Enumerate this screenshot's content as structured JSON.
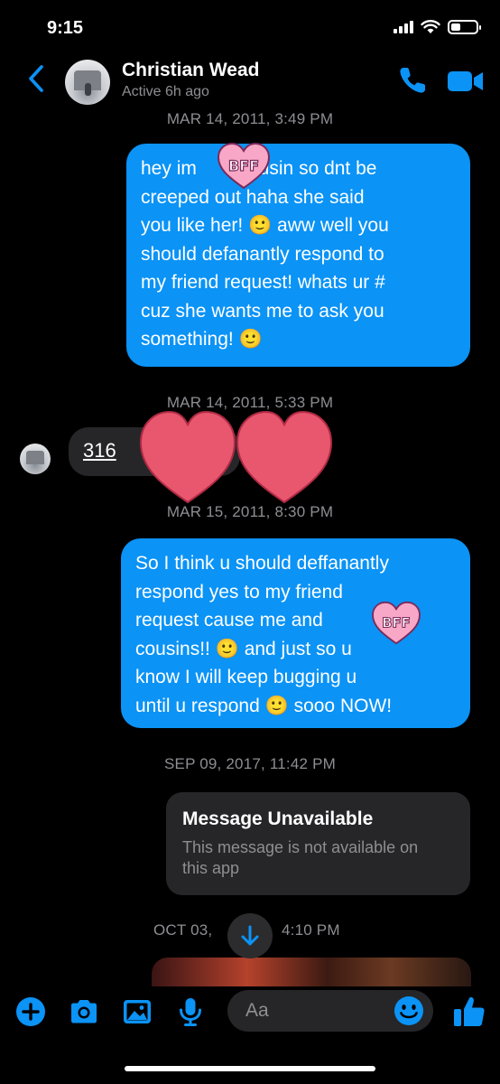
{
  "status_bar": {
    "time": "9:15",
    "battery_fraction": 0.4
  },
  "header": {
    "contact_name": "Christian Wead",
    "contact_status": "Active 6h ago",
    "accent_color": "#0b93f6",
    "icons": [
      "back-chevron-icon",
      "phone-icon",
      "video-camera-icon"
    ]
  },
  "messages": [
    {
      "type": "timestamp",
      "text": "MAR 14, 2011, 3:49 PM"
    },
    {
      "type": "outgoing",
      "lines": [
        "hey im        cousin so dnt be",
        "creeped out haha she said",
        "you like her! 🙂 aww well you",
        "should defanantly respond to",
        "my friend request! whats ur #",
        "cuz she wants me to ask you",
        "something! 🙂"
      ],
      "sticker": "BFF"
    },
    {
      "type": "timestamp",
      "text": "MAR 14, 2011, 5:33 PM"
    },
    {
      "type": "incoming",
      "text": "316"
    },
    {
      "type": "timestamp",
      "text": "MAR 15, 2011, 8:30 PM"
    },
    {
      "type": "outgoing",
      "lines": [
        "So I think u should deffanantly",
        "respond yes to my friend",
        "request cause me and           r",
        "cousins!! 🙂 and just so u",
        "know I will keep bugging u",
        "until u respond 🙂 sooo NOW!"
      ],
      "sticker": "BFF"
    },
    {
      "type": "timestamp",
      "text": "SEP 09, 2017, 11:42 PM"
    },
    {
      "type": "unavailable",
      "title": "Message Unavailable",
      "body_lines": [
        "This message is not available on",
        "this app"
      ]
    },
    {
      "type": "timestamp",
      "text": "OCT 03, 2017, 4:10 PM",
      "visible_left": "OCT 03,",
      "visible_right": "4:10 PM"
    }
  ],
  "composer": {
    "placeholder": "Aa",
    "icons": [
      "plus-icon",
      "camera-icon",
      "image-icon",
      "microphone-icon",
      "emoji-icon",
      "thumbs-up-icon"
    ]
  }
}
